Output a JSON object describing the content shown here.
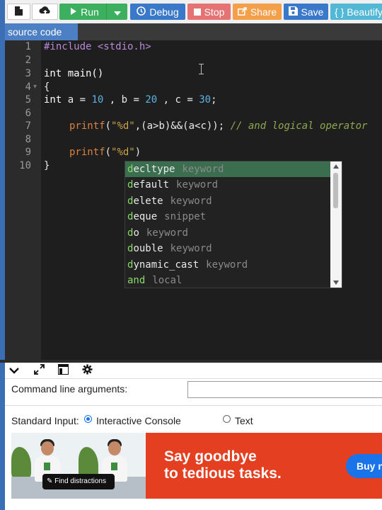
{
  "toolbar": {
    "run_label": "Run",
    "debug_label": "Debug",
    "stop_label": "Stop",
    "share_label": "Share",
    "save_label": "Save",
    "beautify_label": "{ } Beautify",
    "colors": {
      "run": "#3db060",
      "debug": "#3a79c9",
      "stop": "#e57373",
      "share": "#f4a04b",
      "save": "#3a79c9",
      "beautify": "#52b8d6"
    }
  },
  "tabs": [
    {
      "label": "source code"
    }
  ],
  "editor": {
    "line_numbers": [
      "1",
      "2",
      "3",
      "4",
      "5",
      "6",
      "7",
      "8",
      "9",
      "10"
    ],
    "lines": {
      "l1": "#include <stdio.h>",
      "l3": "int main()",
      "l4": "{",
      "l5": {
        "kw": "int",
        "a": " a = ",
        "n1": "10",
        "b": " , b = ",
        "n2": "20",
        "c": " , c = ",
        "n3": "30",
        "end": ";"
      },
      "l7": {
        "fn": "printf",
        "open": "(",
        "str": "\"%d\"",
        "rest": ",(a>b)&&(a<c)); ",
        "comment": "// and logical operator"
      },
      "l9": {
        "fn": "printf",
        "open": "(",
        "str": "\"%d\"",
        "close": ")"
      },
      "l10": "}"
    }
  },
  "autocomplete": {
    "typed": "d",
    "items": [
      {
        "match": "d",
        "rest": "ecltype",
        "meta": "keyword"
      },
      {
        "match": "d",
        "rest": "efault",
        "meta": "keyword"
      },
      {
        "match": "d",
        "rest": "elete",
        "meta": "keyword"
      },
      {
        "match": "d",
        "rest": "eque",
        "meta": "snippet"
      },
      {
        "match": "d",
        "rest": "o",
        "meta": "keyword"
      },
      {
        "match": "d",
        "rest": "ouble",
        "meta": "keyword"
      },
      {
        "match": "d",
        "rest": "ynamic_cast",
        "meta": "keyword"
      },
      {
        "match": "and",
        "rest": "",
        "meta": "local"
      }
    ]
  },
  "panel": {
    "cla_label": "Command line arguments:",
    "cla_value": "",
    "stdin_label": "Standard Input:",
    "radio_interactive": "Interactive Console",
    "radio_text": "Text",
    "selected": "Interactive Console"
  },
  "ad": {
    "pill_label": "Find distractions",
    "headline_line1": "Say goodbye",
    "headline_line2": "to tedious tasks.",
    "button_label": "Buy n"
  }
}
